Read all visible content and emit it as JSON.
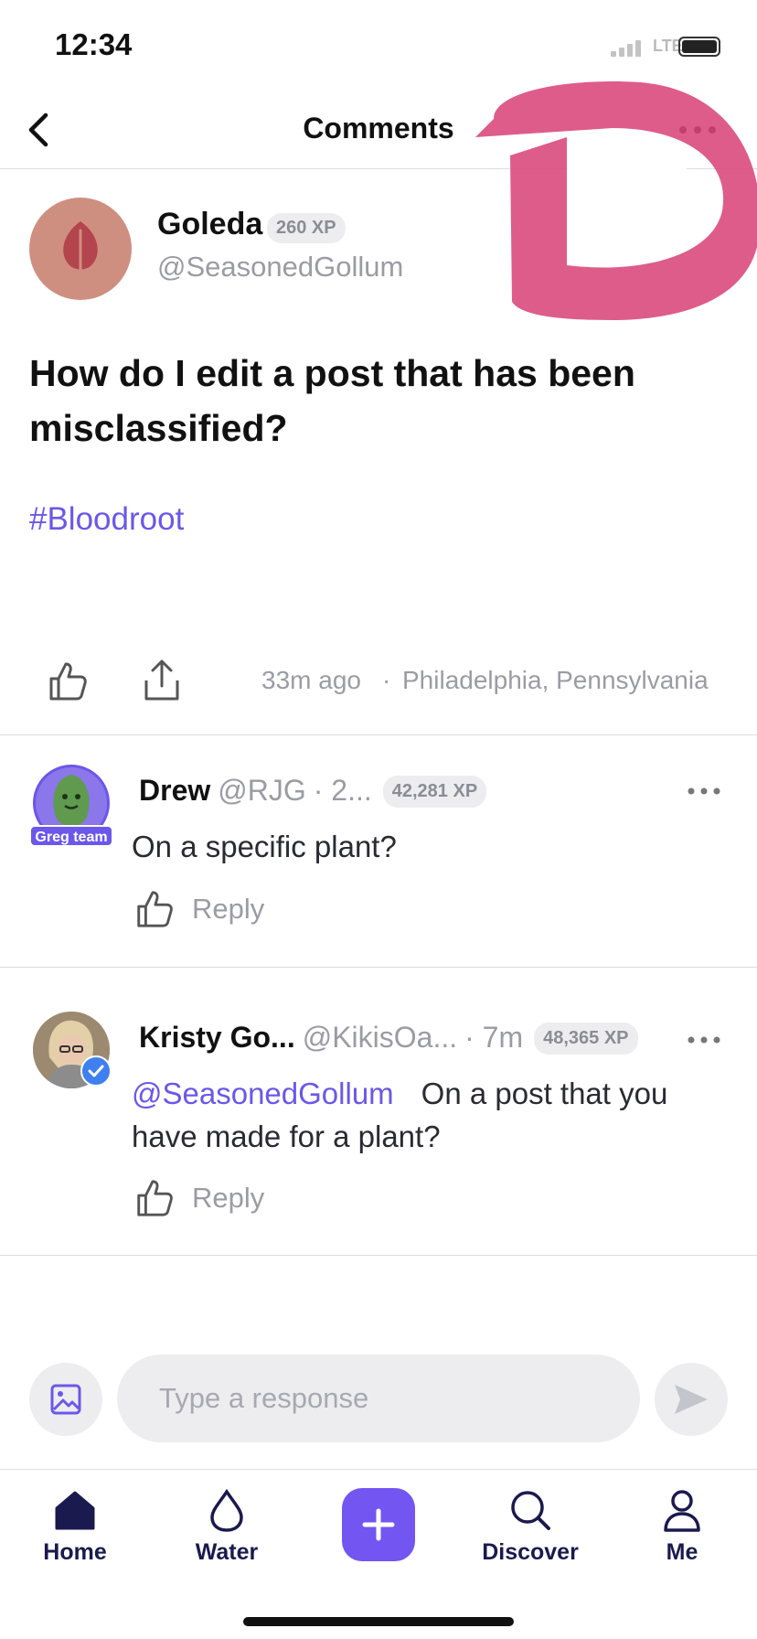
{
  "status": {
    "time": "12:34",
    "network": "LTE"
  },
  "header": {
    "title": "Comments"
  },
  "post": {
    "author_name": "Goleda",
    "author_xp": "260 XP",
    "author_handle": "@SeasonedGollum",
    "question": "How do I edit a post that has been misclassified?",
    "tag": "#Bloodroot",
    "time_ago": "33m ago",
    "separator": "·",
    "location": "Philadelphia, Pennsylvania"
  },
  "comments": [
    {
      "name": "Drew",
      "handle": "@RJG",
      "ago": "· 2...",
      "xp": "42,281 XP",
      "badge": "Greg team",
      "mention": "",
      "text": "On a specific plant?",
      "reply_label": "Reply"
    },
    {
      "name": "Kristy Go...",
      "handle": "@KikisOa...",
      "ago": "· 7m",
      "xp": "48,365 XP",
      "badge": "",
      "mention": "@SeasonedGollum",
      "text": "On a post that you have made for a plant?",
      "reply_label": "Reply"
    }
  ],
  "composer": {
    "placeholder": "Type a response"
  },
  "tabbar": {
    "items": [
      {
        "label": "Home",
        "icon": "home-icon"
      },
      {
        "label": "Water",
        "icon": "water-drop-icon"
      },
      {
        "label": "",
        "icon": "plus-icon"
      },
      {
        "label": "Discover",
        "icon": "search-icon"
      },
      {
        "label": "Me",
        "icon": "person-icon"
      }
    ]
  },
  "colors": {
    "accent": "#6b57ea",
    "add_button": "#7355f1",
    "brush": "#d9467a",
    "muted": "#9b9ba4"
  }
}
